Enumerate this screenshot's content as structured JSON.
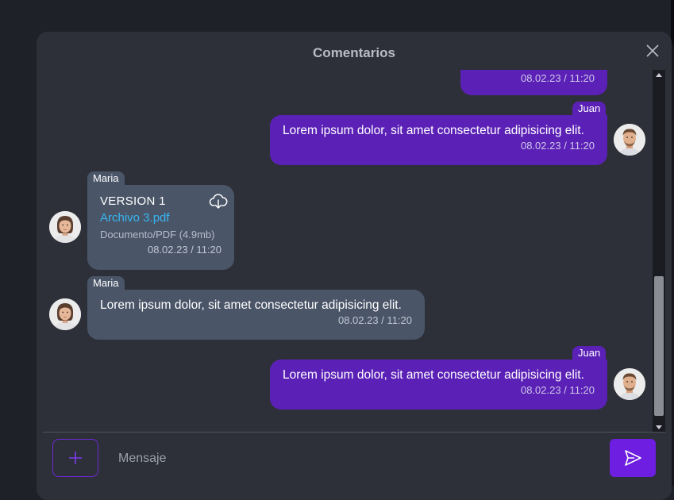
{
  "modal": {
    "title": "Comentarios"
  },
  "messages": [
    {
      "sender": "",
      "text": "",
      "time": "08.02.23 / 11:20",
      "direction": "outgoing",
      "partial": true
    },
    {
      "sender": "Juan",
      "text": "Lorem ipsum dolor, sit amet consectetur adipisicing elit.",
      "time": "08.02.23 / 11:20",
      "direction": "outgoing"
    },
    {
      "sender": "Maria",
      "type": "file",
      "version": "VERSION 1",
      "file_name": "Archivo 3.pdf",
      "file_meta": "Documento/PDF (4.9mb)",
      "time": "08.02.23 / 11:20",
      "direction": "incoming"
    },
    {
      "sender": "Maria",
      "text": "Lorem ipsum dolor, sit amet consectetur adipisicing elit.",
      "time": "08.02.23 / 11:20",
      "direction": "incoming"
    },
    {
      "sender": "Juan",
      "text": "Lorem ipsum dolor, sit amet consectetur adipisicing elit.",
      "time": "08.02.23 / 11:20",
      "direction": "outgoing"
    }
  ],
  "composer": {
    "placeholder": "Mensaje"
  },
  "icons": {
    "close": "close-icon",
    "add": "plus-icon",
    "send": "send-icon",
    "download": "cloud-download-icon"
  },
  "colors": {
    "outgoing_bubble": "#5b21b6",
    "incoming_bubble": "#4a5568",
    "accent": "#6d1ee0",
    "link": "#38b6f2"
  }
}
